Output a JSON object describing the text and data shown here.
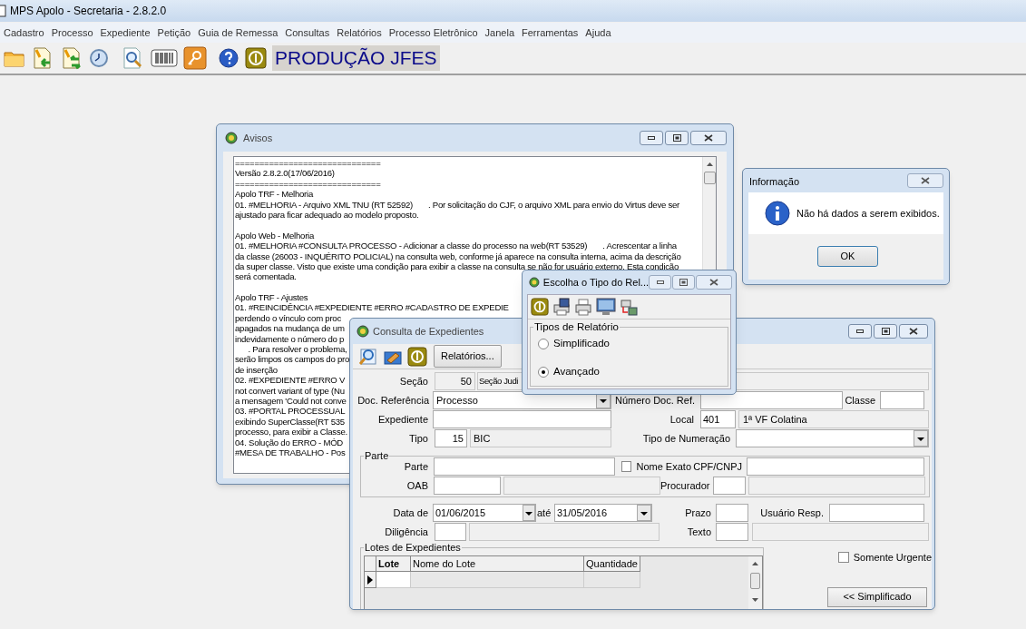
{
  "window": {
    "title": "MPS Apolo - Secretaria - 2.8.2.0"
  },
  "menu": [
    "Cadastro",
    "Processo",
    "Expediente",
    "Petição",
    "Guia de Remessa",
    "Consultas",
    "Relatórios",
    "Processo Eletrônico",
    "Janela",
    "Ferramentas",
    "Ajuda"
  ],
  "toolbar_label": "PRODUÇÃO JFES",
  "avisos": {
    "title": "Avisos",
    "paragraphs": [
      [
        "==============================",
        "Versão 2.8.2.0(17/06/2016)",
        "==============================",
        "Apolo TRF - Melhoria",
        "01. #MELHORIA - Arquivo XML TNU (RT 52592)       . Por solicitação do CJF, o arquivo XML para envio do Virtus deve ser",
        "ajustado para ficar adequado ao modelo proposto."
      ],
      [
        "Apolo Web - Melhoria",
        "01. #MELHORIA #CONSULTA PROCESSO - Adicionar a classe do processo na web(RT 53529)       . Acrescentar a linha",
        "da classe (26003 - INQUÉRITO POLICIAL) na consulta web, conforme já aparece na consulta interna, acima da descrição",
        "da super classe. Visto que existe uma condição para exibir a classe na consulta se não for usuário externo. Esta condição",
        "será comentada."
      ],
      [
        "Apolo TRF - Ajustes",
        "01. #REINCIDÊNCIA #EXPEDIENTE #ERRO #CADASTRO DE EXPEDIE",
        "perdendo o vínculo com proc",
        "apagados na mudança de um",
        "indevidamente o número do p",
        "      . Para resolver o problema,",
        "serão limpos os campos do pro",
        "de inserção",
        "02. #EXPEDIENTE #ERRO V",
        "not convert variant of type (Nu",
        "a mensagem 'Could not conve",
        "03. #PORTAL PROCESSUAL",
        "exibindo SuperClasse(RT 535",
        "processo, para exibir a Classe.",
        "04. Solução do ERRO - MÓD",
        "#MESA DE TRABALHO - Pos"
      ]
    ]
  },
  "info_dialog": {
    "title": "Informação",
    "message": "Não há dados a serem exibidos.",
    "ok": "OK"
  },
  "report_dialog": {
    "title": "Escolha o Tipo do Rel...",
    "group": "Tipos de Relatório",
    "options": [
      {
        "label": "Simplificado",
        "selected": false
      },
      {
        "label": "Avançado",
        "selected": true
      }
    ]
  },
  "consulta": {
    "title": "Consulta de Expedientes",
    "reports_button": "Relatórios...",
    "secao": {
      "label": "Seção",
      "code": "50",
      "name": "Seção Judi"
    },
    "doc_ref": {
      "label": "Doc. Referência",
      "value": "Processo"
    },
    "numero_doc": {
      "label": "Número Doc. Ref."
    },
    "classe": {
      "label": "Classe"
    },
    "expediente": {
      "label": "Expediente"
    },
    "local": {
      "label": "Local",
      "code": "401",
      "name": "1ª VF Colatina"
    },
    "tipo": {
      "label": "Tipo",
      "code": "15",
      "name": "BIC"
    },
    "tipo_numeracao": {
      "label": "Tipo de Numeração"
    },
    "parte_group": "Parte",
    "parte": {
      "label": "Parte"
    },
    "nome_exato": {
      "label": "Nome Exato",
      "checked": false
    },
    "cpf": {
      "label": "CPF/CNPJ"
    },
    "oab": {
      "label": "OAB"
    },
    "procurador": {
      "label": "Procurador"
    },
    "data_de": {
      "label": "Data de",
      "value": "01/06/2015"
    },
    "ate": {
      "label": "até",
      "value": "31/05/2016"
    },
    "prazo": {
      "label": "Prazo"
    },
    "usuario": {
      "label": "Usuário Resp."
    },
    "diligencia": {
      "label": "Diligência"
    },
    "texto": {
      "label": "Texto"
    },
    "lotes": {
      "title": "Lotes de Expedientes",
      "columns": [
        "Lote",
        "Nome do Lote",
        "Quantidade"
      ]
    },
    "somente_urgente": {
      "label": "Somente Urgente",
      "checked": false
    },
    "simplificado_button": "<< Simplificado"
  }
}
